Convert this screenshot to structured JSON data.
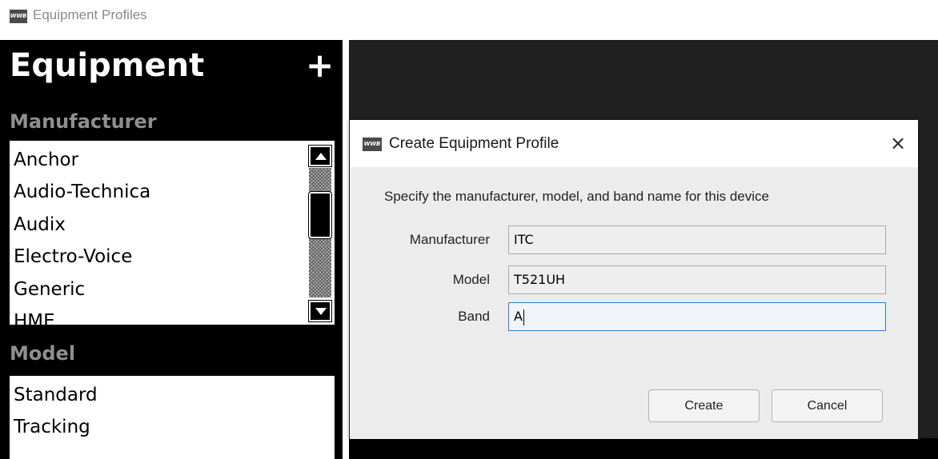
{
  "window": {
    "icon_text": "WWB",
    "title": "Equipment Profiles"
  },
  "left_panel": {
    "title": "Equipment",
    "add_label": "+",
    "manufacturer_label": "Manufacturer",
    "manufacturers": [
      "Anchor",
      "Audio-Technica",
      "Audix",
      "Electro-Voice",
      "Generic",
      "HME"
    ],
    "model_label": "Model",
    "models": [
      "Standard",
      "Tracking"
    ]
  },
  "dialog": {
    "icon_text": "WWB",
    "title": "Create Equipment Profile",
    "close_label": "×",
    "instruction": "Specify the manufacturer, model, and band name for this device",
    "fields": {
      "manufacturer_label": "Manufacturer",
      "manufacturer_value": "ITC",
      "model_label": "Model",
      "model_value": "T521UH",
      "band_label": "Band",
      "band_value": "A"
    },
    "create_label": "Create",
    "cancel_label": "Cancel"
  },
  "colors": {
    "panel_bg": "#000000",
    "section_label": "#8f8f8f",
    "dialog_bg": "#ececec",
    "focus_border": "#2a7fd4"
  }
}
